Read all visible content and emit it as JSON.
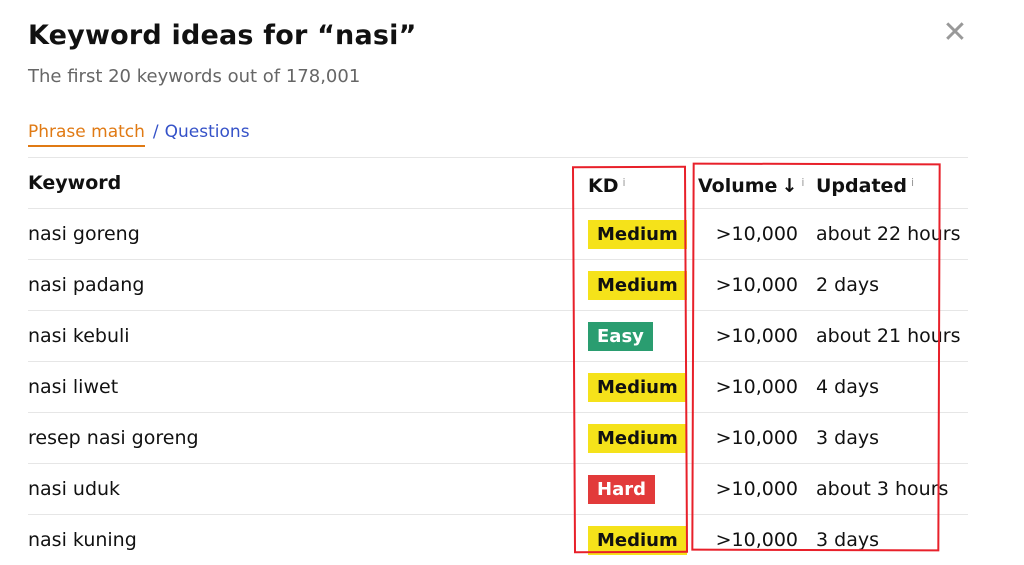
{
  "dialog": {
    "title": "Keyword ideas for “nasi”",
    "subtitle": "The first 20 keywords out of 178,001",
    "close_glyph": "✕"
  },
  "tabs": {
    "active": "Phrase match",
    "separator": "/",
    "other": "Questions"
  },
  "table": {
    "headers": {
      "keyword": "Keyword",
      "kd": "KD",
      "volume": "Volume",
      "sort_arrow": "↓",
      "updated": "Updated",
      "info_glyph": "i"
    },
    "rows": [
      {
        "keyword": "nasi goreng",
        "kd": "Medium",
        "volume": ">10,000",
        "updated": "about 22 hours"
      },
      {
        "keyword": "nasi padang",
        "kd": "Medium",
        "volume": ">10,000",
        "updated": "2 days"
      },
      {
        "keyword": "nasi kebuli",
        "kd": "Easy",
        "volume": ">10,000",
        "updated": "about 21 hours"
      },
      {
        "keyword": "nasi liwet",
        "kd": "Medium",
        "volume": ">10,000",
        "updated": "4 days"
      },
      {
        "keyword": "resep nasi goreng",
        "kd": "Medium",
        "volume": ">10,000",
        "updated": "3 days"
      },
      {
        "keyword": "nasi uduk",
        "kd": "Hard",
        "volume": ">10,000",
        "updated": "about 3 hours"
      },
      {
        "keyword": "nasi kuning",
        "kd": "Medium",
        "volume": ">10,000",
        "updated": "3 days"
      }
    ]
  },
  "colors": {
    "accent_tab": "#e07a14",
    "link": "#3552c8",
    "medium": "#f5e21a",
    "easy": "#2a9d70",
    "hard": "#e23a3a",
    "annotation": "#e8202a"
  }
}
